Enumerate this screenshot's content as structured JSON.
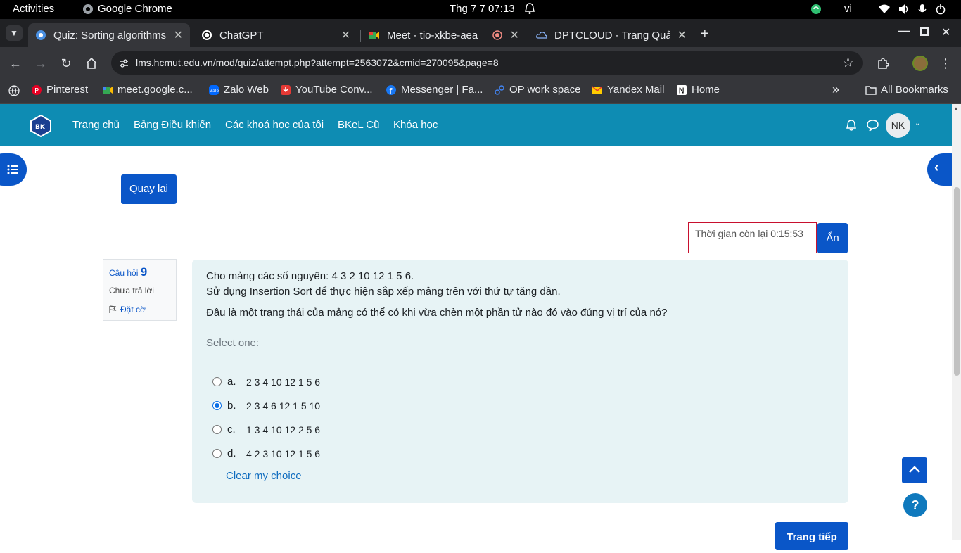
{
  "system": {
    "activities": "Activities",
    "app_name": "Google Chrome",
    "datetime": "Thg 7 7  07:13",
    "lang": "vi"
  },
  "tabs": [
    {
      "title": "Quiz: Sorting algorithms",
      "active": true
    },
    {
      "title": "ChatGPT",
      "active": false
    },
    {
      "title": "Meet - tio-xkbe-aea",
      "active": false
    },
    {
      "title": "DPTCLOUD - Trang Quản",
      "active": false
    }
  ],
  "toolbar": {
    "url": "lms.hcmut.edu.vn/mod/quiz/attempt.php?attempt=2563072&cmid=270095&page=8"
  },
  "bookmarks": [
    {
      "label": "Pinterest"
    },
    {
      "label": "meet.google.c..."
    },
    {
      "label": "Zalo Web"
    },
    {
      "label": "YouTube Conv..."
    },
    {
      "label": "Messenger | Fa..."
    },
    {
      "label": "OP work space"
    },
    {
      "label": "Yandex Mail"
    },
    {
      "label": "Home"
    }
  ],
  "bookmarks_more": "»",
  "all_bookmarks": "All Bookmarks",
  "nav": {
    "links": [
      "Trang chủ",
      "Bảng Điều khiển",
      "Các khoá học của tôi",
      "BKeL Cũ",
      "Khóa học"
    ],
    "avatar": "NK"
  },
  "page": {
    "back_button": "Quay lại",
    "timer_text": "Thời gian còn lại 0:15:53",
    "hide_button": "Ẩn",
    "question_label": "Câu hỏi",
    "question_number": "9",
    "question_status": "Chưa trả lời",
    "flag_label": "Đặt cờ",
    "question_line1": "Cho mảng các số nguyên: 4 3 2 10 12 1 5 6.",
    "question_line2": "Sử dụng Insertion Sort để thực hiện sắp xếp mảng trên với thứ tự tăng dần.",
    "question_line3": "Đâu là một trạng thái của mảng có thể có khi vừa chèn một phần tử nào đó vào đúng vị trí của nó?",
    "select_one": "Select one:",
    "options": [
      {
        "letter": "a.",
        "text": "2 3 4 10 12 1 5 6",
        "checked": false
      },
      {
        "letter": "b.",
        "text": "2 3 4 6 12 1 5 10",
        "checked": true
      },
      {
        "letter": "c.",
        "text": "1 3 4 10 12 2 5 6",
        "checked": false
      },
      {
        "letter": "d.",
        "text": "4 2 3 10 12 1 5 6",
        "checked": false
      }
    ],
    "clear_choice": "Clear my choice",
    "next_button": "Trang tiếp",
    "help_symbol": "?"
  },
  "colors": {
    "nav_bg": "#0e8cb3",
    "primary": "#0a56c8",
    "question_bg": "#e7f3f5",
    "timer_border": "#c8102e"
  }
}
